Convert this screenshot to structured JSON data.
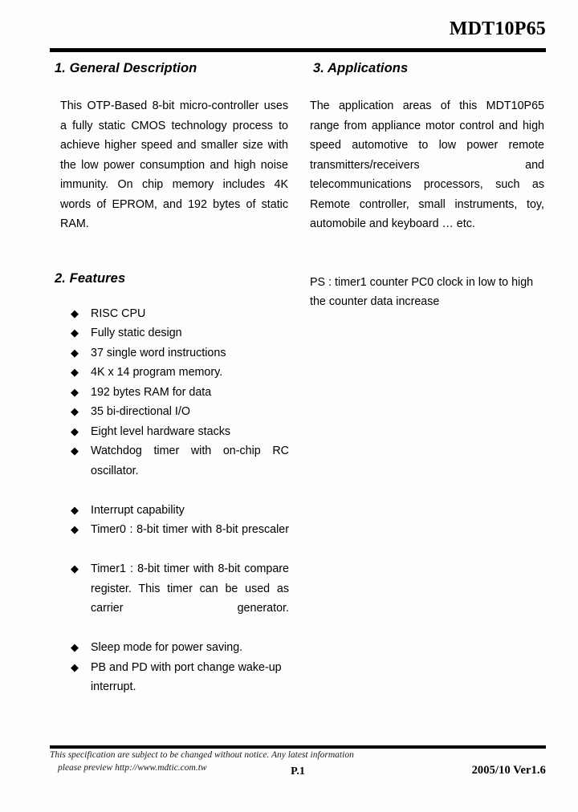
{
  "header": {
    "title": "MDT10P65"
  },
  "sections": {
    "general_description": {
      "heading": "1. General Description",
      "paragraph": "This OTP-Based 8-bit micro-controller uses a fully static CMOS technology process to achieve higher speed and smaller size with the low power consumption and high noise immunity. On chip memory includes 4K words of EPROM, and 192 bytes of static RAM."
    },
    "features": {
      "heading": "2. Features",
      "bullet_glyph": "◆",
      "items": [
        "RISC CPU",
        "Fully static design",
        "37 single word instructions",
        "4K x 14 program memory.",
        "192 bytes RAM for data",
        "35 bi-directional I/O",
        "Eight level hardware stacks",
        "Watchdog timer with on-chip RC oscillator.",
        "Interrupt capability",
        "Timer0 : 8-bit timer with 8-bit prescaler",
        "Timer1 : 8-bit timer with 8-bit compare register. This timer can be used as carrier generator.",
        "Sleep mode for power saving.",
        "PB and PD with port change wake-up interrupt."
      ]
    },
    "applications": {
      "heading": "3. Applications",
      "paragraph": "The application areas of this MDT10P65 range from appliance motor control and high speed automotive to low power remote transmitters/receivers and telecommunications processors, such as Remote controller, small instruments, toy, automobile and keyboard … etc.",
      "note": "PS : timer1 counter PC0 clock in low to high the counter data increase"
    }
  },
  "footer": {
    "disclaimer_line1": "This specification are subject to be changed without notice. Any latest information",
    "disclaimer_line2": "please preview http://www.mdtic.com.tw",
    "page_number": "P.1",
    "version": "2005/10 Ver1.6"
  }
}
